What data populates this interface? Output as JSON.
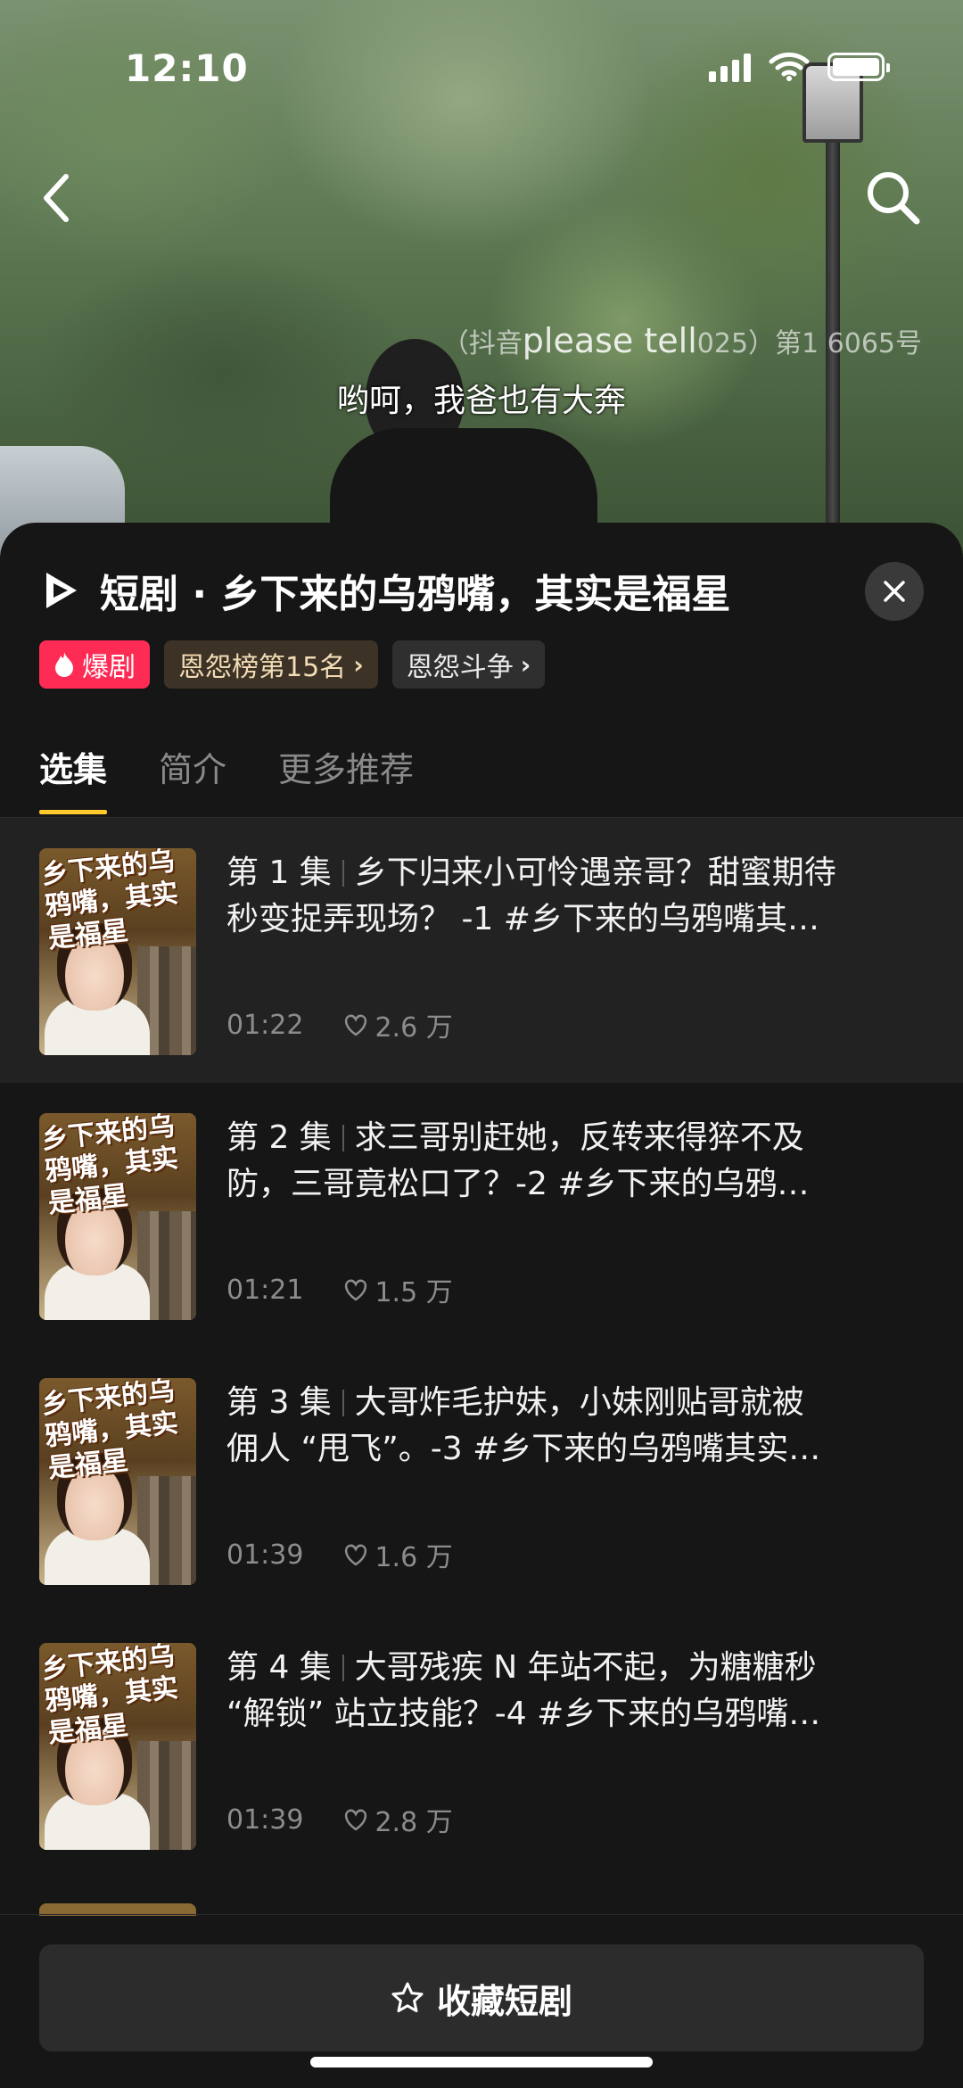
{
  "status_bar": {
    "time": "12:10"
  },
  "video": {
    "watermark_prefix": "（抖音",
    "watermark_en": "please tell",
    "watermark_suffix": "025）第1 6065号",
    "subtitle": "哟呵，我爸也有大奔"
  },
  "sheet": {
    "title": "短剧 · 乡下来的乌鸦嘴，其实是福星",
    "tags": {
      "hot": "爆剧",
      "rank": "恩怨榜第15名",
      "genre": "恩怨斗争"
    },
    "tabs": [
      "选集",
      "简介",
      "更多推荐"
    ],
    "thumb_title": "乡下来的乌鸦嘴，其实是福星",
    "episodes": [
      {
        "number": "第 1 集",
        "line1": "乡下归来小可怜遇亲哥？甜蜜期待",
        "line2": "秒变捉弄现场？ -1 #乡下来的乌鸦嘴其…",
        "duration": "01:22",
        "likes": "2.6 万"
      },
      {
        "number": "第 2 集",
        "line1": "求三哥别赶她，反转来得猝不及",
        "line2": "防，三哥竟松口了？-2 #乡下来的乌鸦…",
        "duration": "01:21",
        "likes": "1.5 万"
      },
      {
        "number": "第 3 集",
        "line1": "大哥炸毛护妹，小妹刚贴哥就被",
        "line2": "佣人 “甩飞”。-3 #乡下来的乌鸦嘴其实…",
        "duration": "01:39",
        "likes": "1.6 万"
      },
      {
        "number": "第 4 集",
        "line1": "大哥残疾 N 年站不起，为糖糖秒",
        "line2": "“解锁” 站立技能？-4 #乡下来的乌鸦嘴…",
        "duration": "01:39",
        "likes": "2.8 万"
      }
    ],
    "favorite_label": "收藏短剧"
  },
  "colors": {
    "accent_tab_underline": "#fdc92d",
    "hot_tag": "#fe2c55",
    "sheet_bg": "#161616"
  },
  "icons": [
    "back-arrow-icon",
    "search-icon",
    "douyin-logo-icon",
    "close-icon",
    "flame-icon",
    "heart-icon",
    "star-icon"
  ]
}
